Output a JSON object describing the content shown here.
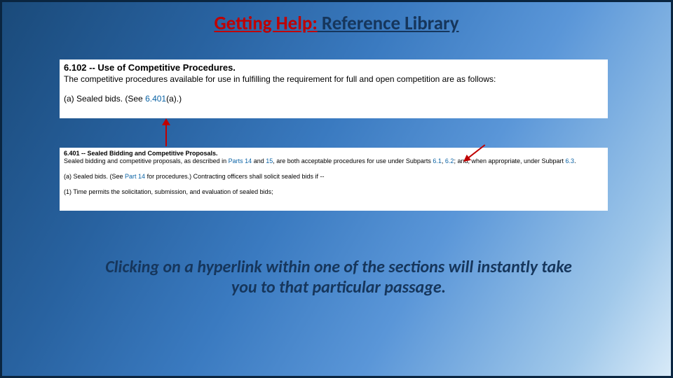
{
  "title": {
    "part1": "Getting Help:",
    "part2": " Reference Library"
  },
  "panel1": {
    "heading": "6.102 -- Use of Competitive Procedures.",
    "text": "The competitive procedures available for use in fulfilling the requirement for full and open competition are as follows:",
    "item_a_pre": "(a) Sealed bids. (See ",
    "item_a_link": "6.401",
    "item_a_post": "(a).)"
  },
  "panel2": {
    "heading": "6.401 -- Sealed Bidding and Competitive Proposals.",
    "text_pre": "Sealed bidding and competitive proposals, as described in ",
    "link_parts14_15": "Parts 14",
    "text_mid1": " and ",
    "link_15": "15",
    "text_mid2": ", are both acceptable procedures for use under Subparts ",
    "link_61": "6.1",
    "text_mid3": ", ",
    "link_62": "6.2",
    "text_mid4": "; and, when appropriate, under Subpart ",
    "link_63": "6.3",
    "text_post": ".",
    "item_a_pre": "(a) Sealed bids. (See ",
    "item_a_link": "Part 14",
    "item_a_post": " for procedures.) Contracting officers shall solicit sealed bids if --",
    "item_1": "(1) Time permits the solicitation, submission, and evaluation of sealed bids;"
  },
  "caption": "Clicking on a hyperlink within one of the sections will instantly take you to that particular passage."
}
